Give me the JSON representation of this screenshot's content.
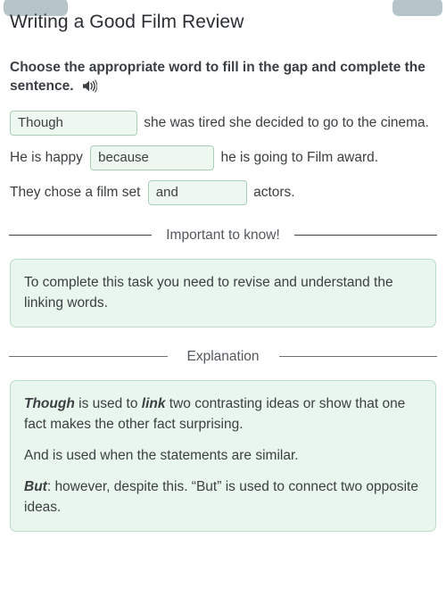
{
  "top_tabs": [
    {
      "name": "tab-left-partial"
    },
    {
      "name": "tab-right-partial"
    }
  ],
  "header": {
    "title": "Writing a Good Film Review"
  },
  "instruction": {
    "text": "Choose the appropriate word to fill in the gap and complete the sentence.",
    "audio_icon": "speaker-icon"
  },
  "exercise": {
    "sentences": [
      {
        "id": "sentence-1",
        "answer": "Though",
        "placeholder": "",
        "before": "",
        "after": " she was tired she decided to go to the cinema."
      },
      {
        "id": "sentence-2",
        "answer": "because",
        "placeholder": "",
        "before": "He is happy ",
        "after": " he is going to Film award."
      },
      {
        "id": "sentence-3",
        "answer": "and",
        "placeholder": "",
        "before": "They chose a film set ",
        "after": " actors."
      }
    ]
  },
  "important_section": {
    "divider_caption": "Important to know!",
    "body": "To complete this task you need to revise and understand the linking words."
  },
  "explanation_section": {
    "divider_caption": "Explanation",
    "paragraphs": [
      {
        "lead": "Though",
        "rest_a": " is used to ",
        "emph": "link",
        "rest_b": " two contrasting ideas or show that one fact makes the other fact surprising."
      },
      {
        "lead": "",
        "rest_a": "And is used when the statements are similar.",
        "emph": "",
        "rest_b": ""
      },
      {
        "lead": "But",
        "rest_a": ": however, despite this. “But” is used to connect two opposite ideas.",
        "emph": "",
        "rest_b": ""
      }
    ]
  },
  "colors": {
    "accent_green_border": "#bcddc7",
    "accent_green_fill": "#e9f6ed",
    "input_border": "#a9cfb6",
    "input_fill": "#eef7f0",
    "text": "#3c4043",
    "tab_gray": "#9fb4b8"
  }
}
